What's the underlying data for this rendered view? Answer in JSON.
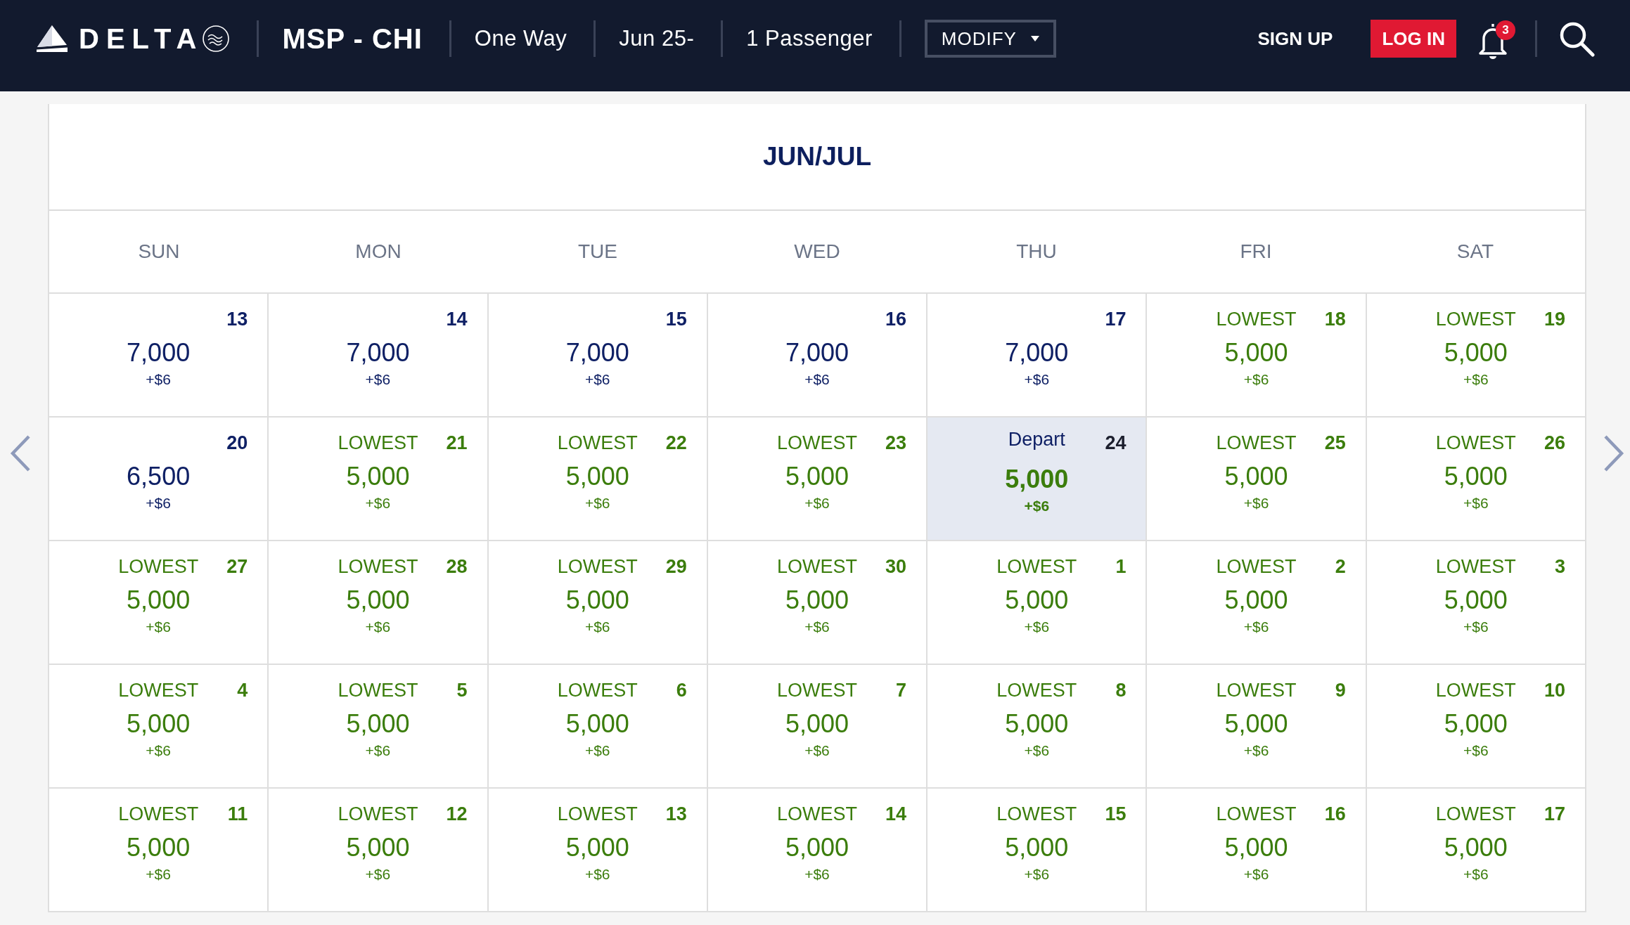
{
  "header": {
    "brand": "DELTA",
    "route": "MSP - CHI",
    "trip_type": "One Way",
    "dates": "Jun 25-",
    "passengers": "1 Passenger",
    "modify_button": "MODIFY",
    "sign_up_link": "SIGN UP",
    "log_in_button": "LOG IN",
    "notification_count": "3"
  },
  "calendar": {
    "title": "JUN/JUL",
    "weekdays": [
      "SUN",
      "MON",
      "TUE",
      "WED",
      "THU",
      "FRI",
      "SAT"
    ],
    "weeks": [
      {
        "days": [
          {
            "day": "13",
            "price": "7,000",
            "fee": "+$6",
            "lowest": false,
            "selected": false
          },
          {
            "day": "14",
            "price": "7,000",
            "fee": "+$6",
            "lowest": false,
            "selected": false
          },
          {
            "day": "15",
            "price": "7,000",
            "fee": "+$6",
            "lowest": false,
            "selected": false
          },
          {
            "day": "16",
            "price": "7,000",
            "fee": "+$6",
            "lowest": false,
            "selected": false
          },
          {
            "day": "17",
            "price": "7,000",
            "fee": "+$6",
            "lowest": false,
            "selected": false
          },
          {
            "day": "18",
            "tag": "LOWEST",
            "price": "5,000",
            "fee": "+$6",
            "lowest": true,
            "selected": false
          },
          {
            "day": "19",
            "tag": "LOWEST",
            "price": "5,000",
            "fee": "+$6",
            "lowest": true,
            "selected": false
          }
        ]
      },
      {
        "days": [
          {
            "day": "20",
            "price": "6,500",
            "fee": "+$6",
            "lowest": false,
            "selected": false
          },
          {
            "day": "21",
            "tag": "LOWEST",
            "price": "5,000",
            "fee": "+$6",
            "lowest": true,
            "selected": false
          },
          {
            "day": "22",
            "tag": "LOWEST",
            "price": "5,000",
            "fee": "+$6",
            "lowest": true,
            "selected": false
          },
          {
            "day": "23",
            "tag": "LOWEST",
            "price": "5,000",
            "fee": "+$6",
            "lowest": true,
            "selected": false
          },
          {
            "day": "24",
            "tag": "Depart",
            "price": "5,000",
            "fee": "+$6",
            "lowest": true,
            "selected": true
          },
          {
            "day": "25",
            "tag": "LOWEST",
            "price": "5,000",
            "fee": "+$6",
            "lowest": true,
            "selected": false
          },
          {
            "day": "26",
            "tag": "LOWEST",
            "price": "5,000",
            "fee": "+$6",
            "lowest": true,
            "selected": false
          }
        ]
      },
      {
        "days": [
          {
            "day": "27",
            "tag": "LOWEST",
            "price": "5,000",
            "fee": "+$6",
            "lowest": true,
            "selected": false
          },
          {
            "day": "28",
            "tag": "LOWEST",
            "price": "5,000",
            "fee": "+$6",
            "lowest": true,
            "selected": false
          },
          {
            "day": "29",
            "tag": "LOWEST",
            "price": "5,000",
            "fee": "+$6",
            "lowest": true,
            "selected": false
          },
          {
            "day": "30",
            "tag": "LOWEST",
            "price": "5,000",
            "fee": "+$6",
            "lowest": true,
            "selected": false
          },
          {
            "day": "1",
            "tag": "LOWEST",
            "price": "5,000",
            "fee": "+$6",
            "lowest": true,
            "selected": false
          },
          {
            "day": "2",
            "tag": "LOWEST",
            "price": "5,000",
            "fee": "+$6",
            "lowest": true,
            "selected": false
          },
          {
            "day": "3",
            "tag": "LOWEST",
            "price": "5,000",
            "fee": "+$6",
            "lowest": true,
            "selected": false
          }
        ]
      },
      {
        "days": [
          {
            "day": "4",
            "tag": "LOWEST",
            "price": "5,000",
            "fee": "+$6",
            "lowest": true,
            "selected": false
          },
          {
            "day": "5",
            "tag": "LOWEST",
            "price": "5,000",
            "fee": "+$6",
            "lowest": true,
            "selected": false
          },
          {
            "day": "6",
            "tag": "LOWEST",
            "price": "5,000",
            "fee": "+$6",
            "lowest": true,
            "selected": false
          },
          {
            "day": "7",
            "tag": "LOWEST",
            "price": "5,000",
            "fee": "+$6",
            "lowest": true,
            "selected": false
          },
          {
            "day": "8",
            "tag": "LOWEST",
            "price": "5,000",
            "fee": "+$6",
            "lowest": true,
            "selected": false
          },
          {
            "day": "9",
            "tag": "LOWEST",
            "price": "5,000",
            "fee": "+$6",
            "lowest": true,
            "selected": false
          },
          {
            "day": "10",
            "tag": "LOWEST",
            "price": "5,000",
            "fee": "+$6",
            "lowest": true,
            "selected": false
          }
        ]
      },
      {
        "days": [
          {
            "day": "11",
            "tag": "LOWEST",
            "price": "5,000",
            "fee": "+$6",
            "lowest": true,
            "selected": false
          },
          {
            "day": "12",
            "tag": "LOWEST",
            "price": "5,000",
            "fee": "+$6",
            "lowest": true,
            "selected": false
          },
          {
            "day": "13",
            "tag": "LOWEST",
            "price": "5,000",
            "fee": "+$6",
            "lowest": true,
            "selected": false
          },
          {
            "day": "14",
            "tag": "LOWEST",
            "price": "5,000",
            "fee": "+$6",
            "lowest": true,
            "selected": false
          },
          {
            "day": "15",
            "tag": "LOWEST",
            "price": "5,000",
            "fee": "+$6",
            "lowest": true,
            "selected": false
          },
          {
            "day": "16",
            "tag": "LOWEST",
            "price": "5,000",
            "fee": "+$6",
            "lowest": true,
            "selected": false
          },
          {
            "day": "17",
            "tag": "LOWEST",
            "price": "5,000",
            "fee": "+$6",
            "lowest": true,
            "selected": false
          }
        ]
      }
    ]
  }
}
